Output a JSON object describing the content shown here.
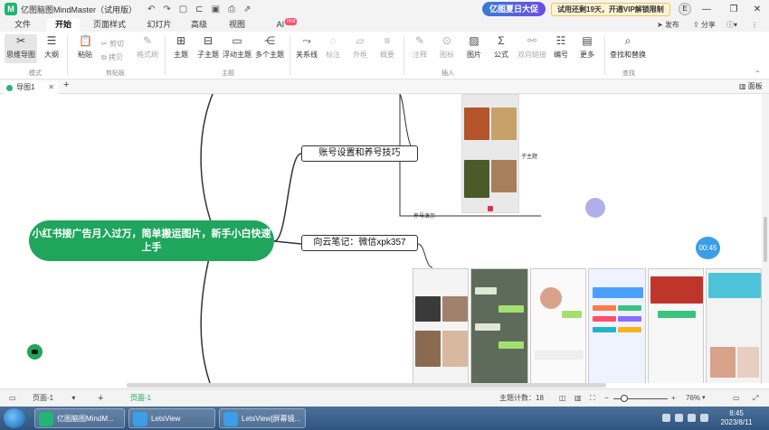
{
  "window": {
    "title": "亿图脑图MindMaster（试用版）",
    "promo": "亿图夏日大促",
    "trial_notice": "试用还剩19天，开通VIP解锁限制",
    "avatar_letter": "E",
    "publish": "发布",
    "share": "分享",
    "help": "?"
  },
  "menu": {
    "tabs": [
      "文件",
      "开始",
      "页面样式",
      "幻灯片",
      "高级",
      "视图",
      "AI"
    ],
    "hot": "Hot"
  },
  "ribbon": {
    "mode_group": "模式",
    "mind_map": "思维导图",
    "outline": "大纲",
    "paste": "粘贴",
    "cut": "剪切",
    "copy": "拷贝",
    "format_painter": "格式刷",
    "clipboard_group": "剪贴板",
    "main_topic": "主题",
    "sub_topic": "子主题",
    "float_topic": "浮动主题",
    "multi_topic": "多个主题",
    "topic_group": "主题",
    "relation": "关系线",
    "callout": "标注",
    "boundary": "外框",
    "summary": "概要",
    "note": "注释",
    "icon": "图标",
    "image": "图片",
    "formula": "公式",
    "two_way_link": "双向链接",
    "numbering": "编号",
    "more": "更多",
    "insert_group": "插入",
    "find_replace": "查找和替换",
    "find_group": "查找",
    "panel": "面板"
  },
  "doc_tab": {
    "label": "导图1"
  },
  "canvas": {
    "central_topic": "小红书接广告月入过万，简单搬运图片，新手小白快速上手",
    "topic_account": "账号设置和养号技巧",
    "topic_contact": "向云笔记：微信xpk357",
    "label_subtopic": "子主题",
    "label_demo": "养号演示",
    "timer": "00:45"
  },
  "status": {
    "page_select": "页面-1",
    "page_tab": "页面-1",
    "topic_count": "主题计数：18",
    "zoom": "76%"
  },
  "taskbar": {
    "app1": "亿图脑图MindM...",
    "app2": "LetsView",
    "app3": "LetsView[屏幕镜...",
    "time": "8:45",
    "date": "2023/8/11"
  },
  "colors": {
    "brand_green": "#1fa55c",
    "promo_blue": "#3a7bd5",
    "trial_bg": "#fff4d6"
  }
}
